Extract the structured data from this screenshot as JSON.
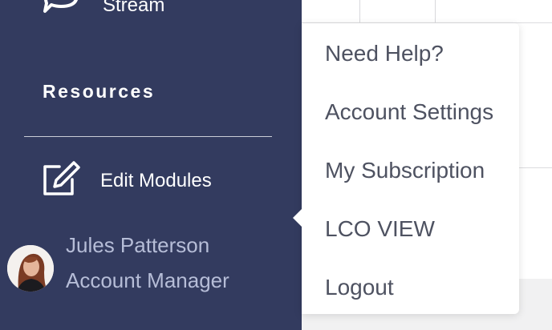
{
  "sidebar": {
    "stream_label": "Stream",
    "section_title": "Resources",
    "edit_modules_label": "Edit Modules",
    "user": {
      "name": "Jules Patterson",
      "role": "Account Manager"
    }
  },
  "dropdown": {
    "items": [
      {
        "label": "Need Help?"
      },
      {
        "label": "Account Settings"
      },
      {
        "label": "My Subscription"
      },
      {
        "label": "LCO VIEW"
      },
      {
        "label": "Logout"
      }
    ]
  },
  "colors": {
    "sidebar_bg": "#333b5f",
    "menu_text": "#4e5261",
    "user_text": "#b6bdd7"
  }
}
